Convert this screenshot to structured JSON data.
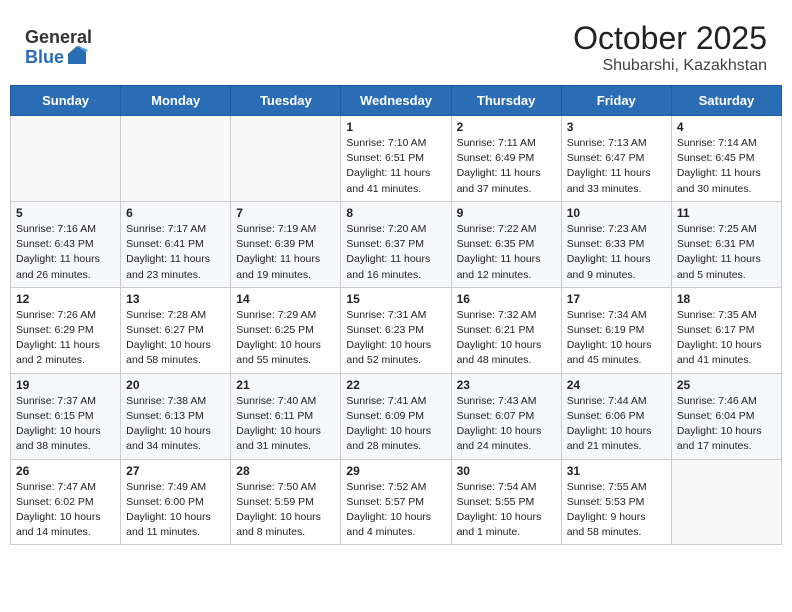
{
  "header": {
    "logo_general": "General",
    "logo_blue": "Blue",
    "title": "October 2025",
    "subtitle": "Shubarshi, Kazakhstan"
  },
  "weekdays": [
    "Sunday",
    "Monday",
    "Tuesday",
    "Wednesday",
    "Thursday",
    "Friday",
    "Saturday"
  ],
  "weeks": [
    [
      {
        "day": "",
        "sunrise": "",
        "sunset": "",
        "daylight": ""
      },
      {
        "day": "",
        "sunrise": "",
        "sunset": "",
        "daylight": ""
      },
      {
        "day": "",
        "sunrise": "",
        "sunset": "",
        "daylight": ""
      },
      {
        "day": "1",
        "sunrise": "Sunrise: 7:10 AM",
        "sunset": "Sunset: 6:51 PM",
        "daylight": "Daylight: 11 hours and 41 minutes."
      },
      {
        "day": "2",
        "sunrise": "Sunrise: 7:11 AM",
        "sunset": "Sunset: 6:49 PM",
        "daylight": "Daylight: 11 hours and 37 minutes."
      },
      {
        "day": "3",
        "sunrise": "Sunrise: 7:13 AM",
        "sunset": "Sunset: 6:47 PM",
        "daylight": "Daylight: 11 hours and 33 minutes."
      },
      {
        "day": "4",
        "sunrise": "Sunrise: 7:14 AM",
        "sunset": "Sunset: 6:45 PM",
        "daylight": "Daylight: 11 hours and 30 minutes."
      }
    ],
    [
      {
        "day": "5",
        "sunrise": "Sunrise: 7:16 AM",
        "sunset": "Sunset: 6:43 PM",
        "daylight": "Daylight: 11 hours and 26 minutes."
      },
      {
        "day": "6",
        "sunrise": "Sunrise: 7:17 AM",
        "sunset": "Sunset: 6:41 PM",
        "daylight": "Daylight: 11 hours and 23 minutes."
      },
      {
        "day": "7",
        "sunrise": "Sunrise: 7:19 AM",
        "sunset": "Sunset: 6:39 PM",
        "daylight": "Daylight: 11 hours and 19 minutes."
      },
      {
        "day": "8",
        "sunrise": "Sunrise: 7:20 AM",
        "sunset": "Sunset: 6:37 PM",
        "daylight": "Daylight: 11 hours and 16 minutes."
      },
      {
        "day": "9",
        "sunrise": "Sunrise: 7:22 AM",
        "sunset": "Sunset: 6:35 PM",
        "daylight": "Daylight: 11 hours and 12 minutes."
      },
      {
        "day": "10",
        "sunrise": "Sunrise: 7:23 AM",
        "sunset": "Sunset: 6:33 PM",
        "daylight": "Daylight: 11 hours and 9 minutes."
      },
      {
        "day": "11",
        "sunrise": "Sunrise: 7:25 AM",
        "sunset": "Sunset: 6:31 PM",
        "daylight": "Daylight: 11 hours and 5 minutes."
      }
    ],
    [
      {
        "day": "12",
        "sunrise": "Sunrise: 7:26 AM",
        "sunset": "Sunset: 6:29 PM",
        "daylight": "Daylight: 11 hours and 2 minutes."
      },
      {
        "day": "13",
        "sunrise": "Sunrise: 7:28 AM",
        "sunset": "Sunset: 6:27 PM",
        "daylight": "Daylight: 10 hours and 58 minutes."
      },
      {
        "day": "14",
        "sunrise": "Sunrise: 7:29 AM",
        "sunset": "Sunset: 6:25 PM",
        "daylight": "Daylight: 10 hours and 55 minutes."
      },
      {
        "day": "15",
        "sunrise": "Sunrise: 7:31 AM",
        "sunset": "Sunset: 6:23 PM",
        "daylight": "Daylight: 10 hours and 52 minutes."
      },
      {
        "day": "16",
        "sunrise": "Sunrise: 7:32 AM",
        "sunset": "Sunset: 6:21 PM",
        "daylight": "Daylight: 10 hours and 48 minutes."
      },
      {
        "day": "17",
        "sunrise": "Sunrise: 7:34 AM",
        "sunset": "Sunset: 6:19 PM",
        "daylight": "Daylight: 10 hours and 45 minutes."
      },
      {
        "day": "18",
        "sunrise": "Sunrise: 7:35 AM",
        "sunset": "Sunset: 6:17 PM",
        "daylight": "Daylight: 10 hours and 41 minutes."
      }
    ],
    [
      {
        "day": "19",
        "sunrise": "Sunrise: 7:37 AM",
        "sunset": "Sunset: 6:15 PM",
        "daylight": "Daylight: 10 hours and 38 minutes."
      },
      {
        "day": "20",
        "sunrise": "Sunrise: 7:38 AM",
        "sunset": "Sunset: 6:13 PM",
        "daylight": "Daylight: 10 hours and 34 minutes."
      },
      {
        "day": "21",
        "sunrise": "Sunrise: 7:40 AM",
        "sunset": "Sunset: 6:11 PM",
        "daylight": "Daylight: 10 hours and 31 minutes."
      },
      {
        "day": "22",
        "sunrise": "Sunrise: 7:41 AM",
        "sunset": "Sunset: 6:09 PM",
        "daylight": "Daylight: 10 hours and 28 minutes."
      },
      {
        "day": "23",
        "sunrise": "Sunrise: 7:43 AM",
        "sunset": "Sunset: 6:07 PM",
        "daylight": "Daylight: 10 hours and 24 minutes."
      },
      {
        "day": "24",
        "sunrise": "Sunrise: 7:44 AM",
        "sunset": "Sunset: 6:06 PM",
        "daylight": "Daylight: 10 hours and 21 minutes."
      },
      {
        "day": "25",
        "sunrise": "Sunrise: 7:46 AM",
        "sunset": "Sunset: 6:04 PM",
        "daylight": "Daylight: 10 hours and 17 minutes."
      }
    ],
    [
      {
        "day": "26",
        "sunrise": "Sunrise: 7:47 AM",
        "sunset": "Sunset: 6:02 PM",
        "daylight": "Daylight: 10 hours and 14 minutes."
      },
      {
        "day": "27",
        "sunrise": "Sunrise: 7:49 AM",
        "sunset": "Sunset: 6:00 PM",
        "daylight": "Daylight: 10 hours and 11 minutes."
      },
      {
        "day": "28",
        "sunrise": "Sunrise: 7:50 AM",
        "sunset": "Sunset: 5:59 PM",
        "daylight": "Daylight: 10 hours and 8 minutes."
      },
      {
        "day": "29",
        "sunrise": "Sunrise: 7:52 AM",
        "sunset": "Sunset: 5:57 PM",
        "daylight": "Daylight: 10 hours and 4 minutes."
      },
      {
        "day": "30",
        "sunrise": "Sunrise: 7:54 AM",
        "sunset": "Sunset: 5:55 PM",
        "daylight": "Daylight: 10 hours and 1 minute."
      },
      {
        "day": "31",
        "sunrise": "Sunrise: 7:55 AM",
        "sunset": "Sunset: 5:53 PM",
        "daylight": "Daylight: 9 hours and 58 minutes."
      },
      {
        "day": "",
        "sunrise": "",
        "sunset": "",
        "daylight": ""
      }
    ]
  ]
}
